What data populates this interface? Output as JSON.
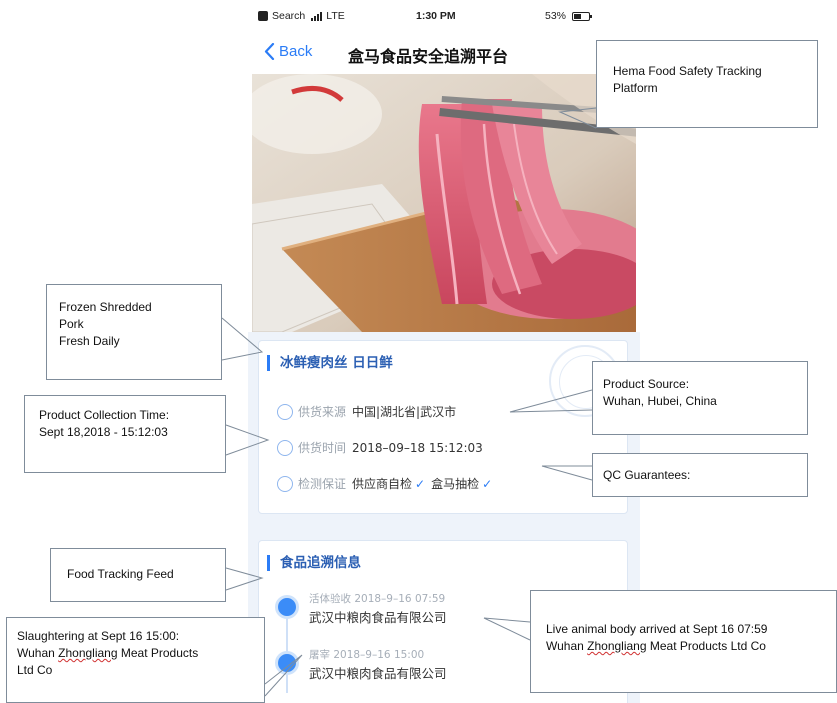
{
  "status_bar": {
    "back_app": "Search",
    "network": "LTE",
    "time": "1:30 PM",
    "battery": "53%",
    "battery_level": 0.53
  },
  "nav": {
    "back_label": "Back",
    "title": "盒马食品安全追溯平台"
  },
  "product_card": {
    "title": "冰鲜瘦肉丝 日日鲜",
    "rows": [
      {
        "icon": "location-pin-icon",
        "label": "供货来源",
        "value": "中国|湖北省|武汉市"
      },
      {
        "icon": "clock-icon",
        "label": "供货时间",
        "value": "2018–09–18 15:12:03"
      },
      {
        "icon": "shield-person-icon",
        "label": "检测保证",
        "checks": [
          "供应商自检",
          "盒马抽检"
        ]
      }
    ]
  },
  "tracking_card": {
    "title": "食品追溯信息",
    "events": [
      {
        "icon": "check-circle-icon",
        "meta": "活体验收 2018–9–16 07:59",
        "company": "武汉中粮肉食品有限公司"
      },
      {
        "icon": "knife-icon",
        "meta": "屠宰 2018–9–16 15:00",
        "company": "武汉中粮肉食品有限公司"
      }
    ]
  },
  "annotations": {
    "hema": "Hema Food Safety Tracking Platform",
    "pork": "Frozen Shredded\nPork\nFresh Daily",
    "source": "Product Source:\nWuhan, Hubei, China",
    "collect": "Product Collection Time:\nSept 18,2018 - 15:12:03",
    "qc": "QC Guarantees:",
    "feed": "Food Tracking Feed",
    "live_prefix": "Live animal body arrived at Sept 16 07:59\nWuhan ",
    "live_squiggle": "Zhongliang",
    "live_suffix": " Meat Products Ltd Co",
    "slaughter_prefix": "Slaughtering at Sept 16 15:00:\nWuhan ",
    "slaughter_squiggle": "Zhongliang",
    "slaughter_suffix": " Meat Products\nLtd Co"
  },
  "colors": {
    "accent": "#2b7cf6",
    "card_title": "#2b5fb3",
    "muted_label": "#9aa3ad",
    "page_bg": "#eef3fa"
  }
}
